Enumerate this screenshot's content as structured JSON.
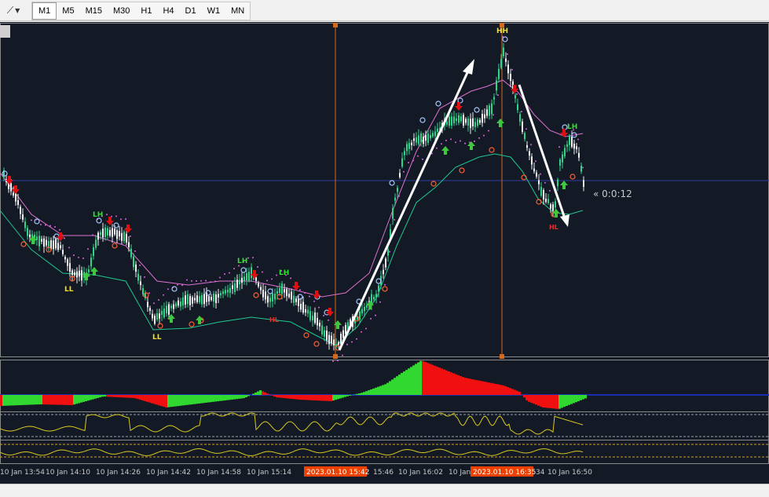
{
  "toolbar": {
    "timeframes": [
      "M1",
      "M5",
      "M15",
      "M30",
      "H1",
      "H4",
      "D1",
      "W1",
      "MN"
    ],
    "active": "M1"
  },
  "chart": {
    "countdown": "« 0:0:12",
    "time_labels": [
      "10 Jan 13:54",
      "10 Jan 14:10",
      "10 Jan 14:26",
      "10 Jan 14:42",
      "10 Jan 14:58",
      "10 Jan 15:14",
      "15:46",
      "10 Jan 16:02",
      "10 Jan 16:18",
      "34",
      "10 Jan 16:50"
    ],
    "cursor_labels": [
      "2023.01.10 15:42",
      "2023.01.10 16:35"
    ],
    "swing_labels": {
      "ll_1": "LL",
      "ll_2": "LL",
      "lh_1": "LH",
      "lh_2": "LH",
      "lh_3": "LH",
      "hl_1": "HL",
      "hl_2": "HL",
      "hh": "HH",
      "lh_4": "LH"
    }
  },
  "colors": {
    "background": "#131a26",
    "bull": "#2ed58a",
    "bear": "#f0f0f0",
    "up_arrow": "#3fc83f",
    "down_arrow": "#e01010",
    "upper_band": "#e070d0",
    "lower_band": "#20c890",
    "oscillator": "#d8c820",
    "cursor": "#d2691e"
  }
}
